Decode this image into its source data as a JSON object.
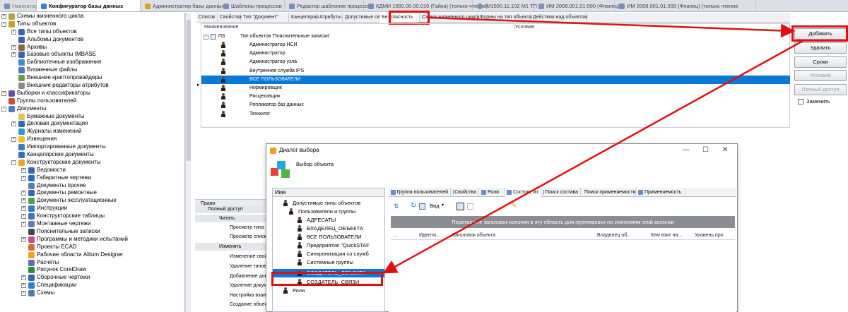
{
  "top_tabs": [
    "Навигатор",
    "Конфигуратор базы данных",
    "Администратор базы данных",
    "Шаблоны процессов",
    "Редактор шаблонов процессов",
    "КДМИ 1000.00.00.010 (Гайка) (только чтение)",
    "IM1000.11.102 М1 ТП",
    "ИМ 2008.001.01.000 (Фланец)",
    "ИМ 2008.001.01.000 (Фланец) (только чтение"
  ],
  "tree": [
    "Схемы жизненного цикла",
    "Типы объектов",
    "Все типы объектов",
    "Альбомы документов",
    "Архивы",
    "Базовые объекты IMBASE",
    "Библиотечные изображения",
    "Вложенные файлы",
    "Внешние криптопровайдеры",
    "Внешние редакторы атрибутов",
    "Выборки и классификаторы",
    "Группы пользователей",
    "Документы",
    "Бумажные документы",
    "Деловая документация",
    "Журналы изменений",
    "Извещения",
    "Импортированные документы",
    "Канцелярские документы",
    "Конструкторские документы",
    "Ведомости",
    "Габаритные чертежи",
    "Документы прочие",
    "Документы ремонтные",
    "Документы эксплуатационные",
    "Инструкции",
    "Конструкторские таблицы",
    "Монтажные чертежи",
    "Пояснительные записки",
    "Программы и методики испытаний",
    "Проекты ECAD",
    "Рабочие области Altium Designer",
    "Расчёты",
    "Рисунок CorelDraw",
    "Сборочные чертежи",
    "Спецификации",
    "Схемы"
  ],
  "panel_tabs": [
    "Список",
    "Свойства",
    "Тип \"Документ\"",
    "Канцелярия",
    "Атрибуты",
    "Допустимые связи",
    "Безопасность",
    "Схема жизненного цикла",
    "Формы на тип объекта",
    "Действия над объектом"
  ],
  "grid": {
    "col_name": "Наименование",
    "col_cond": "Условие",
    "group_code": "ПЗ",
    "group_label": "Тип объектов 'Пояснительные записки'",
    "rows": [
      "Администратор НСИ",
      "Администратор",
      "Администратор узла",
      "Внутренняя служба IPS",
      "ВСЕ ПОЛЬЗОВАТЕЛИ",
      "Нормировщик",
      "Расцеховщик",
      "Репликатор баз данных",
      "Технолог"
    ]
  },
  "buttons": {
    "add": "Добавить",
    "delete": "Удалить",
    "terms": "Сроки",
    "condition": "Условие",
    "full_access": "Полный доступ",
    "replace": "Заменить"
  },
  "rights": {
    "header": "Право",
    "rows": [
      "Полный доступ",
      "Читать",
      "Просмотр типа о",
      "Просмотр списка",
      "Изменять",
      "Изменение свой",
      "Удаление типов с",
      "Добавление доку",
      "Удаление докуме",
      "Настройка взаим",
      "Создание объект"
    ]
  },
  "dialog": {
    "title": "Диалог выбора",
    "subtitle": "Выбор объекта",
    "tree_header": "Имя",
    "tree": [
      "Допустимые типы объектов",
      "Пользователи и группы",
      "АДРЕСАТЫ",
      "ВЛАДЕЛЕЦ_ОБЪЕКТА",
      "ВСЕ ПОЛЬЗОВАТЕЛИ",
      "Предприятие \"QuickSTAF",
      "Синхронизация со служб",
      "Системные группы",
      "СОЗДАТЕЛЬ_ОБЪЕКТА",
      "СОЗДАТЕЛЬ_СВЯЗИ",
      "Роли"
    ],
    "tabs": [
      "Группа пользователей",
      "Свойства",
      "Роли",
      "Состоит из",
      "Поиск состава",
      "Поиск применяемости",
      "Применяемость"
    ],
    "view_label": "Вид",
    "group_hint": "Перетащите заголовок колонки в эту область для группировки по значениям этой колонки",
    "columns": [
      "...",
      "Иденти...",
      "Заголовок объекта",
      "Владелец об...",
      "Кем взят на...",
      "Уровень про"
    ]
  },
  "colors": {
    "selection": "#0a78d7",
    "highlight": "#e01010"
  }
}
